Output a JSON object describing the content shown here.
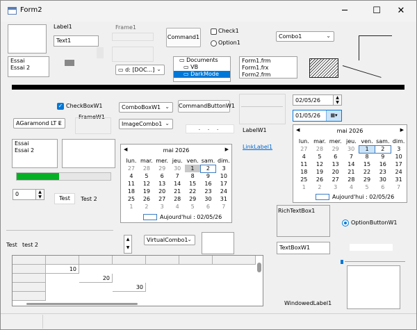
{
  "window": {
    "title": "Form2",
    "minimize": "─",
    "maximize": "☐",
    "close": "✕"
  },
  "labels": {
    "label1": "Label1",
    "text1": "Text1",
    "frame1": "Frame1",
    "command1": "Command1",
    "check1": "Check1",
    "option1": "Option1",
    "combo1": "Combo1",
    "checkboxw1": "CheckBoxW1",
    "framew1": "FrameW1",
    "comboboxw1": "ComboBoxW1",
    "commandbuttonw1": "CommandButtonW1",
    "imagecombo1": "ImageCombo1",
    "labelw1": "LabelW1",
    "linklabel1": "LinkLabel1",
    "richtextbox1": "RichTextBox1",
    "optionbuttonw1": "OptionButtonW1",
    "textboxw1": "TextBoxW1",
    "virtualcombo1": "VirtualCombo1",
    "windowedlabel1": "WindowedLabel1",
    "tab_test": "Test",
    "tab_test2": "Test 2",
    "test": "Test",
    "test2": "test 2",
    "font_combo": "AGaramond LT E",
    "updown_value": "0",
    "dots": ". . ."
  },
  "list_essai": [
    "Essai",
    "Essai 2"
  ],
  "list_essai2": [
    "Essai",
    "Essai 2"
  ],
  "drive": "d: [DOC...]",
  "dirs": [
    "Documents",
    "VB",
    "DarkMode"
  ],
  "files": [
    "Form1.frm",
    "Form1.frx",
    "Form2.frm"
  ],
  "date1": "02/05/26",
  "date2": "01/05/26",
  "calendar_left": {
    "month": "mai 2026",
    "weekdays": [
      "lun.",
      "mar.",
      "mer.",
      "jeu.",
      "ven.",
      "sam.",
      "dim."
    ],
    "rows": [
      [
        "27",
        "28",
        "29",
        "30",
        "1",
        "2",
        "3"
      ],
      [
        "4",
        "5",
        "6",
        "7",
        "8",
        "9",
        "10"
      ],
      [
        "11",
        "12",
        "13",
        "14",
        "15",
        "16",
        "17"
      ],
      [
        "18",
        "19",
        "20",
        "21",
        "22",
        "23",
        "24"
      ],
      [
        "25",
        "26",
        "27",
        "28",
        "29",
        "30",
        "31"
      ],
      [
        "1",
        "2",
        "3",
        "4",
        "5",
        "6",
        "7"
      ]
    ],
    "today_label": "Aujourd'hui : 02/05/26"
  },
  "calendar_right": {
    "month": "mai 2026",
    "weekdays": [
      "lun.",
      "mar.",
      "mer.",
      "jeu.",
      "ven.",
      "sam.",
      "dim."
    ],
    "rows": [
      [
        "27",
        "28",
        "29",
        "30",
        "1",
        "2",
        "3"
      ],
      [
        "4",
        "5",
        "6",
        "7",
        "8",
        "9",
        "10"
      ],
      [
        "11",
        "12",
        "13",
        "14",
        "15",
        "16",
        "17"
      ],
      [
        "18",
        "19",
        "20",
        "21",
        "22",
        "23",
        "24"
      ],
      [
        "25",
        "26",
        "27",
        "28",
        "29",
        "30",
        "31"
      ],
      [
        "1",
        "2",
        "3",
        "4",
        "5",
        "6",
        "7"
      ]
    ],
    "today_label": "Aujourd'hui : 02/05/26"
  },
  "progress": {
    "value": 0.45,
    "color": "#06b025"
  },
  "grid_values": [
    "10",
    "20",
    "30"
  ],
  "colors": {
    "accent": "#0078d7",
    "link": "#0066cc"
  }
}
